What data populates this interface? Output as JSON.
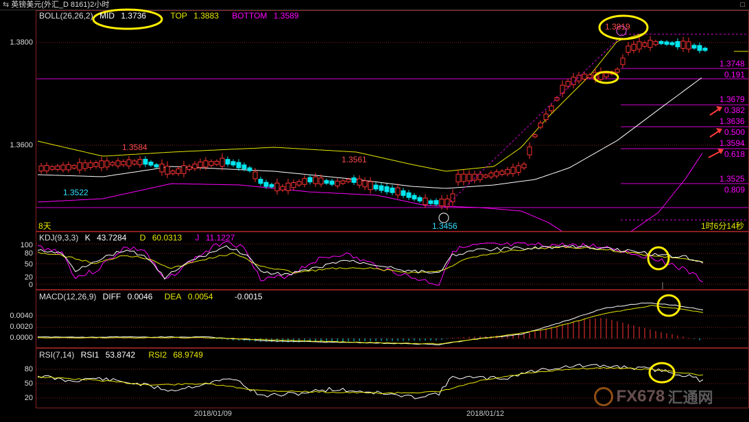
{
  "window": {
    "title": "英镑美元(外汇_D 8161)2小时",
    "nav_icon": "arrows-icon",
    "maximize_icon": "restore-icon"
  },
  "colors": {
    "up": "#ff3333",
    "down": "#00e5ee",
    "yellow": "#e8e800",
    "magenta": "#ff00ff",
    "white": "#ffffff",
    "grid": "#8a2020",
    "fib": "#d400d4",
    "circle": "#ffee00"
  },
  "main_panel": {
    "legend": {
      "name": "BOLL(26,26,2)",
      "mid_label": "MID",
      "mid_value": "1.3736",
      "top_label": "TOP",
      "top_value": "1.3883",
      "bottom_label": "BOTTOM",
      "bottom_value": "1.3589"
    },
    "y_ticks": [
      "1.3800",
      "1.3600"
    ],
    "annotations": {
      "high_left": "1.3584",
      "low_left": "1.3522",
      "high_mid": "1.3561",
      "low_mid": "1.3456",
      "peak": "1.3819",
      "interval": "8天",
      "countdown": "1时6分14秒"
    },
    "fib_levels": [
      {
        "price": "1.3748",
        "ratio": "0.191"
      },
      {
        "price": "1.3679",
        "ratio": "0.382"
      },
      {
        "price": "1.3636",
        "ratio": "0.500"
      },
      {
        "price": "1.3594",
        "ratio": "0.618"
      },
      {
        "price": "1.3525",
        "ratio": "0.809"
      }
    ]
  },
  "kdj_panel": {
    "legend": {
      "name": "KDJ(9,3,3)",
      "k_label": "K",
      "k_value": "43.7284",
      "d_label": "D",
      "d_value": "60.0313",
      "j_label": "J",
      "j_value": "11.1227"
    },
    "y_ticks": [
      "100",
      "80",
      "50",
      "20",
      "0"
    ]
  },
  "macd_panel": {
    "legend": {
      "name": "MACD(12,26,9)",
      "diff_label": "DIFF",
      "diff_value": "0.0046",
      "dea_label": "DEA",
      "dea_value": "0.0054",
      "macd_value": "-0.0015"
    },
    "y_ticks": [
      "0.0040",
      "0.0020",
      "0.0000"
    ]
  },
  "rsi_panel": {
    "legend": {
      "name": "RSI(7,14)",
      "rsi1_label": "RSI1",
      "rsi1_value": "53.8742",
      "rsi2_label": "RSI2",
      "rsi2_value": "68.9749"
    },
    "y_ticks": [
      "80",
      "50",
      "20"
    ]
  },
  "x_axis": {
    "dates": [
      "2018/01/09",
      "2018/01/12"
    ]
  },
  "watermark": {
    "brand": "FX678",
    "cn": "汇通网"
  }
}
